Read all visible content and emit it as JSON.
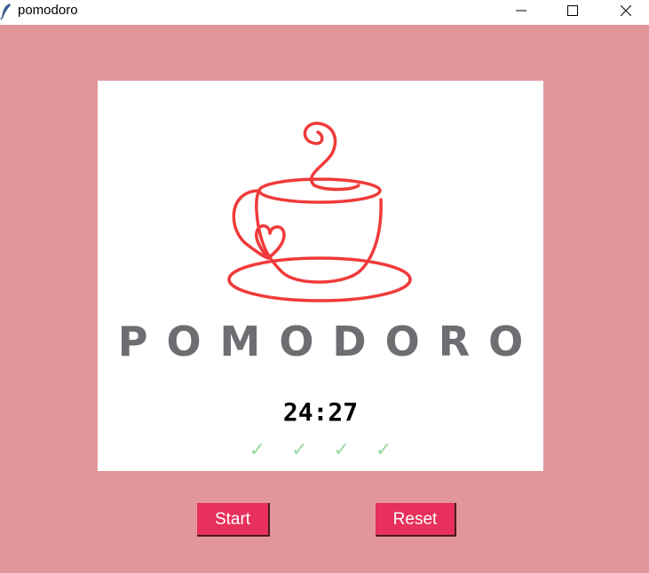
{
  "window": {
    "title": "pomodoro",
    "app_icon": "feather-icon",
    "controls": [
      "minimize-icon",
      "maximize-icon",
      "close-icon"
    ]
  },
  "logo": {
    "icon": "coffee-cup-heart-icon",
    "text": "POMODORO",
    "accent_color": "#f03a3a",
    "text_color": "#6d6e72"
  },
  "timer": {
    "display": "24:27"
  },
  "progress": {
    "checkmarks": "✓ ✓ ✓ ✓",
    "completed_sessions": 4,
    "color": "#9bd9a6"
  },
  "buttons": {
    "start_label": "Start",
    "reset_label": "Reset",
    "color": "#e7305b"
  },
  "theme": {
    "background": "#e1979a",
    "canvas": "#ffffff"
  }
}
